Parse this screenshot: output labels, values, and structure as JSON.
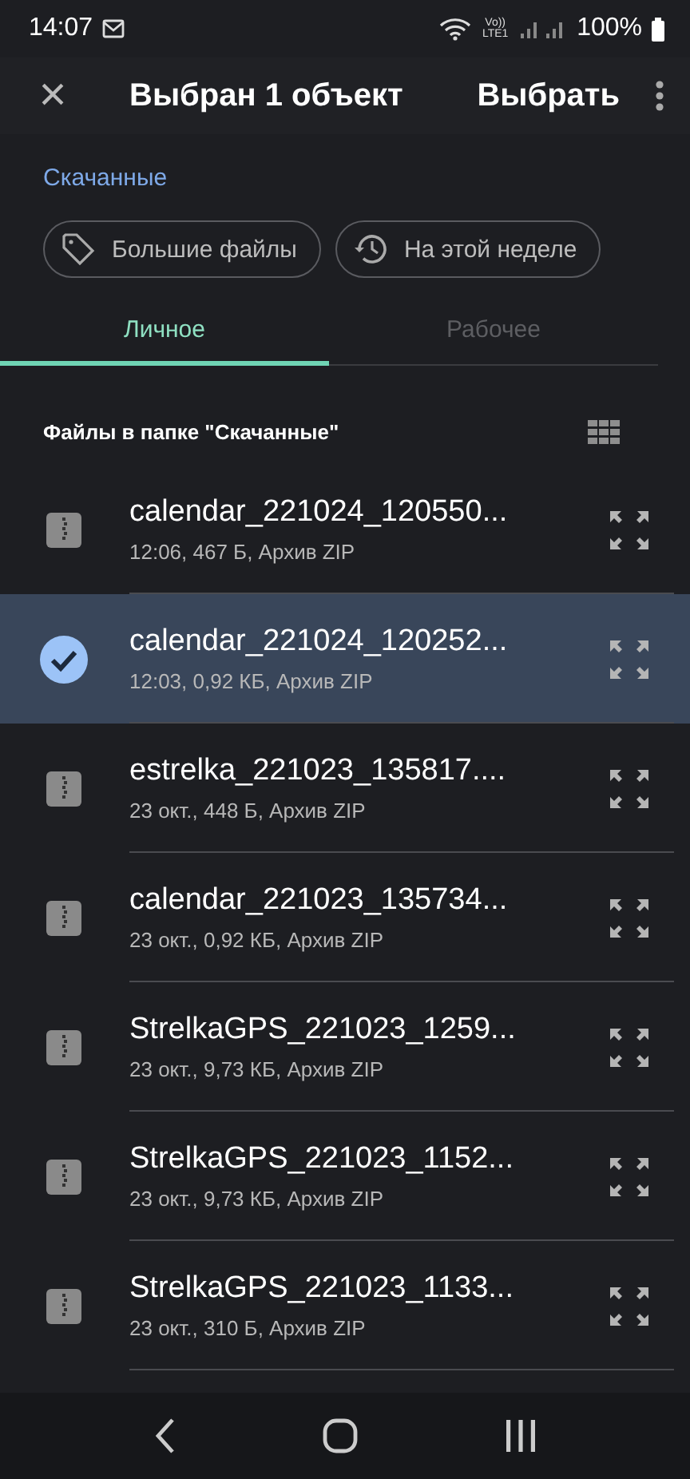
{
  "status_bar": {
    "time": "14:07",
    "network_label": "Vo)) LTE1",
    "battery": "100%"
  },
  "app_bar": {
    "close": "×",
    "title": "Выбран 1 объект",
    "action": "Выбрать"
  },
  "breadcrumb": "Скачанные",
  "chips": [
    {
      "label": "Большие файлы",
      "kind": "tag"
    },
    {
      "label": "На этой неделе",
      "kind": "history"
    }
  ],
  "tabs": [
    {
      "label": "Личное",
      "selected": true
    },
    {
      "label": "Рабочее",
      "selected": false
    }
  ],
  "section_title": "Файлы в папке \"Скачанные\"",
  "files": [
    {
      "name": "calendar_221024_120550...",
      "meta": "12:06, 467 Б, Архив ZIP",
      "selected": false
    },
    {
      "name": "calendar_221024_120252...",
      "meta": "12:03, 0,92 КБ, Архив ZIP",
      "selected": true
    },
    {
      "name": "estrelka_221023_135817....",
      "meta": "23 окт., 448 Б, Архив ZIP",
      "selected": false
    },
    {
      "name": "calendar_221023_135734...",
      "meta": "23 окт., 0,92 КБ, Архив ZIP",
      "selected": false
    },
    {
      "name": "StrelkaGPS_221023_1259...",
      "meta": "23 окт., 9,73 КБ, Архив ZIP",
      "selected": false
    },
    {
      "name": "StrelkaGPS_221023_1152...",
      "meta": "23 окт., 9,73 КБ, Архив ZIP",
      "selected": false
    },
    {
      "name": "StrelkaGPS_221023_1133...",
      "meta": "23 окт., 310 Б, Архив ZIP",
      "selected": false
    }
  ]
}
